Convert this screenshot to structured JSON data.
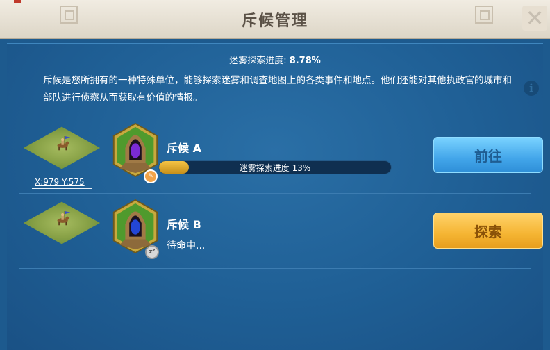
{
  "header": {
    "title": "斥候管理"
  },
  "summary": {
    "label": "迷雾探索进度: ",
    "value": "8.78%",
    "description": "斥候是您所拥有的一种特殊单位，能够探索迷雾和调查地图上的各类事件和地点。他们还能对其他执政官的城市和部队进行侦察从而获取有价值的情报。"
  },
  "scouts": [
    {
      "coords": "X:979 Y:575",
      "name": "斥候 A",
      "progress_text": "迷雾探索进度 13%",
      "progress": 0.13,
      "button": "前往",
      "hood_color": "#7a2bd6"
    },
    {
      "name": "斥候 B",
      "status": "待命中...",
      "button": "探索",
      "hood_color": "#2346d6"
    }
  ],
  "colors": {
    "panel": "#1f5f95",
    "button_go": "#43a6ea",
    "button_explore": "#f5b533",
    "progress_fill": "#f5c344"
  },
  "icons": [
    "close-icon",
    "info-icon",
    "mounted-scout-icon",
    "hooded-scout-portrait",
    "scroll-icon",
    "sleep-icon"
  ]
}
